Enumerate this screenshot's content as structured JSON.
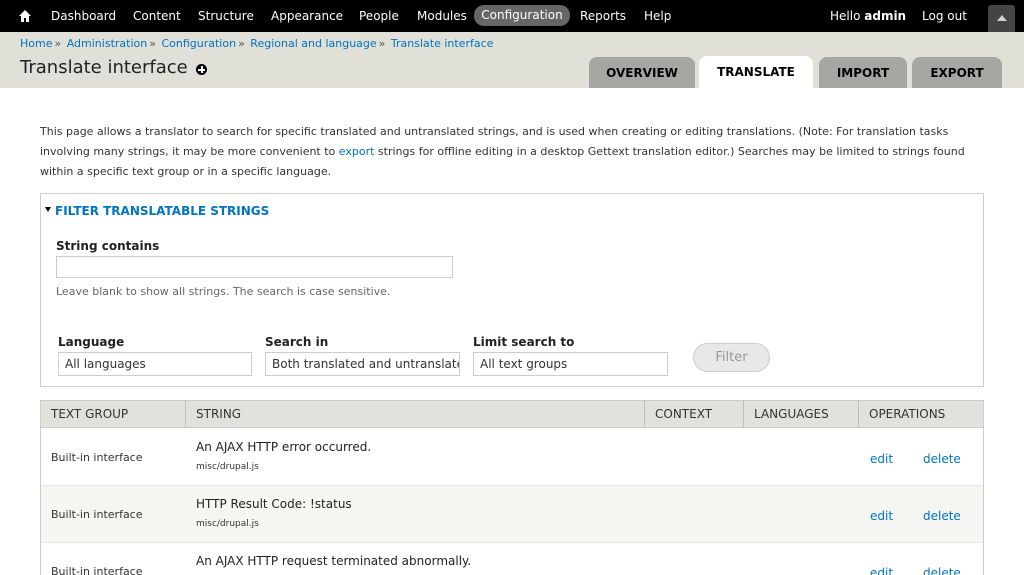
{
  "toolbar": {
    "home_icon": "home-icon",
    "items": [
      {
        "label": "Dashboard"
      },
      {
        "label": "Content"
      },
      {
        "label": "Structure"
      },
      {
        "label": "Appearance"
      },
      {
        "label": "People"
      },
      {
        "label": "Modules"
      },
      {
        "label": "Configuration"
      },
      {
        "label": "Reports"
      },
      {
        "label": "Help"
      }
    ],
    "hello_prefix": "Hello",
    "username": "admin",
    "logout": "Log out",
    "active_color": "#666666"
  },
  "breadcrumb": [
    "Home",
    "Administration",
    "Configuration",
    "Regional and language",
    "Translate interface"
  ],
  "page_title": "Translate interface",
  "tabs": [
    {
      "label": "Overview",
      "active": false
    },
    {
      "label": "Translate",
      "active": true
    },
    {
      "label": "Import",
      "active": false
    },
    {
      "label": "Export",
      "active": false
    }
  ],
  "intro": {
    "before_link": "This page allows a translator to search for specific translated and untranslated strings, and is used when creating or editing translations. (Note: For translation tasks involving many strings, it may be more convenient to ",
    "link": "export",
    "after_link": " strings for offline editing in a desktop Gettext translation editor.) Searches may be limited to strings found within a specific text group or in a specific language."
  },
  "filter": {
    "legend": "Filter translatable strings",
    "string_contains_label": "String contains",
    "string_contains_value": "",
    "help": "Leave blank to show all strings. The search is case sensitive.",
    "language_label": "Language",
    "language_value": "All languages",
    "search_in_label": "Search in",
    "search_in_value": "Both translated and untranslated strings",
    "limit_label": "Limit search to",
    "limit_value": "All text groups",
    "filter_button": "Filter"
  },
  "table": {
    "headers": [
      "Text group",
      "String",
      "Context",
      "Languages",
      "Operations"
    ],
    "rows": [
      {
        "group": "Built-in interface",
        "string": "An AJAX HTTP error occurred.",
        "file": "misc/drupal.js",
        "edit": "edit",
        "delete": "delete"
      },
      {
        "group": "Built-in interface",
        "string": "HTTP Result Code: !status",
        "file": "misc/drupal.js",
        "edit": "edit",
        "delete": "delete"
      },
      {
        "group": "Built-in interface",
        "string": "An AJAX HTTP request terminated abnormally.",
        "file": "",
        "edit": "edit",
        "delete": "delete"
      }
    ]
  },
  "colors": {
    "link": "#0074bd",
    "header_bg": "#e0e0d8",
    "tab_bg": "#a6a7a2"
  }
}
